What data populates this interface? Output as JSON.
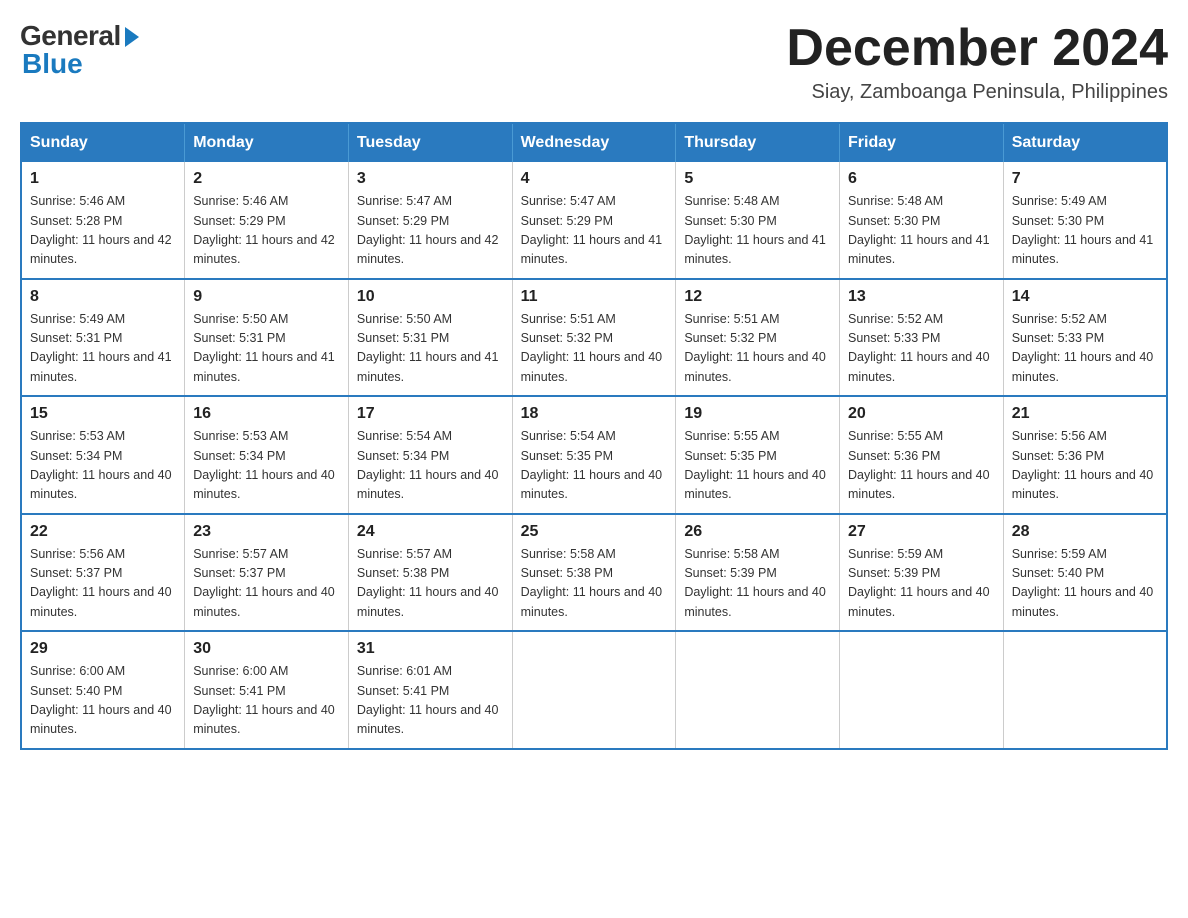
{
  "logo": {
    "general": "General",
    "blue": "Blue"
  },
  "header": {
    "month_title": "December 2024",
    "location": "Siay, Zamboanga Peninsula, Philippines"
  },
  "days_of_week": [
    "Sunday",
    "Monday",
    "Tuesday",
    "Wednesday",
    "Thursday",
    "Friday",
    "Saturday"
  ],
  "weeks": [
    [
      {
        "day": "1",
        "sunrise": "5:46 AM",
        "sunset": "5:28 PM",
        "daylight": "11 hours and 42 minutes."
      },
      {
        "day": "2",
        "sunrise": "5:46 AM",
        "sunset": "5:29 PM",
        "daylight": "11 hours and 42 minutes."
      },
      {
        "day": "3",
        "sunrise": "5:47 AM",
        "sunset": "5:29 PM",
        "daylight": "11 hours and 42 minutes."
      },
      {
        "day": "4",
        "sunrise": "5:47 AM",
        "sunset": "5:29 PM",
        "daylight": "11 hours and 41 minutes."
      },
      {
        "day": "5",
        "sunrise": "5:48 AM",
        "sunset": "5:30 PM",
        "daylight": "11 hours and 41 minutes."
      },
      {
        "day": "6",
        "sunrise": "5:48 AM",
        "sunset": "5:30 PM",
        "daylight": "11 hours and 41 minutes."
      },
      {
        "day": "7",
        "sunrise": "5:49 AM",
        "sunset": "5:30 PM",
        "daylight": "11 hours and 41 minutes."
      }
    ],
    [
      {
        "day": "8",
        "sunrise": "5:49 AM",
        "sunset": "5:31 PM",
        "daylight": "11 hours and 41 minutes."
      },
      {
        "day": "9",
        "sunrise": "5:50 AM",
        "sunset": "5:31 PM",
        "daylight": "11 hours and 41 minutes."
      },
      {
        "day": "10",
        "sunrise": "5:50 AM",
        "sunset": "5:31 PM",
        "daylight": "11 hours and 41 minutes."
      },
      {
        "day": "11",
        "sunrise": "5:51 AM",
        "sunset": "5:32 PM",
        "daylight": "11 hours and 40 minutes."
      },
      {
        "day": "12",
        "sunrise": "5:51 AM",
        "sunset": "5:32 PM",
        "daylight": "11 hours and 40 minutes."
      },
      {
        "day": "13",
        "sunrise": "5:52 AM",
        "sunset": "5:33 PM",
        "daylight": "11 hours and 40 minutes."
      },
      {
        "day": "14",
        "sunrise": "5:52 AM",
        "sunset": "5:33 PM",
        "daylight": "11 hours and 40 minutes."
      }
    ],
    [
      {
        "day": "15",
        "sunrise": "5:53 AM",
        "sunset": "5:34 PM",
        "daylight": "11 hours and 40 minutes."
      },
      {
        "day": "16",
        "sunrise": "5:53 AM",
        "sunset": "5:34 PM",
        "daylight": "11 hours and 40 minutes."
      },
      {
        "day": "17",
        "sunrise": "5:54 AM",
        "sunset": "5:34 PM",
        "daylight": "11 hours and 40 minutes."
      },
      {
        "day": "18",
        "sunrise": "5:54 AM",
        "sunset": "5:35 PM",
        "daylight": "11 hours and 40 minutes."
      },
      {
        "day": "19",
        "sunrise": "5:55 AM",
        "sunset": "5:35 PM",
        "daylight": "11 hours and 40 minutes."
      },
      {
        "day": "20",
        "sunrise": "5:55 AM",
        "sunset": "5:36 PM",
        "daylight": "11 hours and 40 minutes."
      },
      {
        "day": "21",
        "sunrise": "5:56 AM",
        "sunset": "5:36 PM",
        "daylight": "11 hours and 40 minutes."
      }
    ],
    [
      {
        "day": "22",
        "sunrise": "5:56 AM",
        "sunset": "5:37 PM",
        "daylight": "11 hours and 40 minutes."
      },
      {
        "day": "23",
        "sunrise": "5:57 AM",
        "sunset": "5:37 PM",
        "daylight": "11 hours and 40 minutes."
      },
      {
        "day": "24",
        "sunrise": "5:57 AM",
        "sunset": "5:38 PM",
        "daylight": "11 hours and 40 minutes."
      },
      {
        "day": "25",
        "sunrise": "5:58 AM",
        "sunset": "5:38 PM",
        "daylight": "11 hours and 40 minutes."
      },
      {
        "day": "26",
        "sunrise": "5:58 AM",
        "sunset": "5:39 PM",
        "daylight": "11 hours and 40 minutes."
      },
      {
        "day": "27",
        "sunrise": "5:59 AM",
        "sunset": "5:39 PM",
        "daylight": "11 hours and 40 minutes."
      },
      {
        "day": "28",
        "sunrise": "5:59 AM",
        "sunset": "5:40 PM",
        "daylight": "11 hours and 40 minutes."
      }
    ],
    [
      {
        "day": "29",
        "sunrise": "6:00 AM",
        "sunset": "5:40 PM",
        "daylight": "11 hours and 40 minutes."
      },
      {
        "day": "30",
        "sunrise": "6:00 AM",
        "sunset": "5:41 PM",
        "daylight": "11 hours and 40 minutes."
      },
      {
        "day": "31",
        "sunrise": "6:01 AM",
        "sunset": "5:41 PM",
        "daylight": "11 hours and 40 minutes."
      },
      null,
      null,
      null,
      null
    ]
  ],
  "labels": {
    "sunrise": "Sunrise:",
    "sunset": "Sunset:",
    "daylight": "Daylight:"
  }
}
